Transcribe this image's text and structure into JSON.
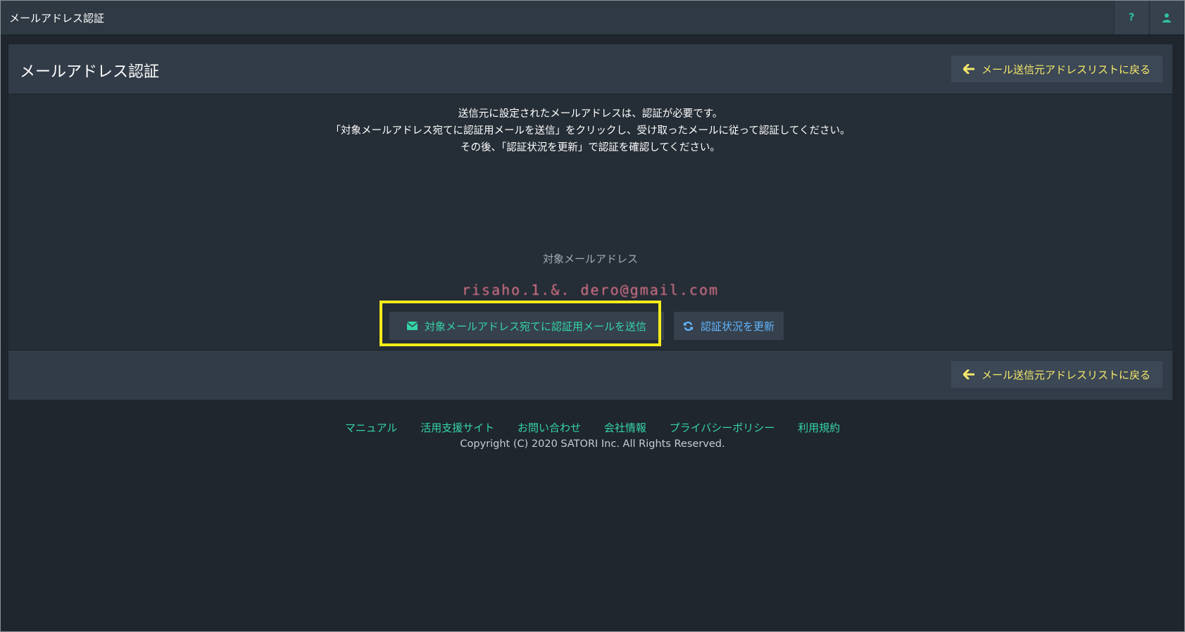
{
  "app": {
    "title": "メールアドレス認証"
  },
  "topbar": {
    "help_label": "?"
  },
  "page": {
    "title": "メールアドレス認証",
    "back_button": "メール送信元アドレスリストに戻る"
  },
  "instructions": {
    "line1": "送信元に設定されたメールアドレスは、認証が必要です。",
    "line2": "「対象メールアドレス宛てに認証用メールを送信」をクリックし、受け取ったメールに従って認証してください。",
    "line3": "その後、「認証状況を更新」で認証を確認してください。"
  },
  "target": {
    "label": "対象メールアドレス",
    "email": "risaho.1.&. dero@gmail.com"
  },
  "actions": {
    "send_label": "対象メールアドレス宛てに認証用メールを送信",
    "refresh_label": "認証状況を更新"
  },
  "footer": {
    "links": [
      "マニュアル",
      "活用支援サイト",
      "お問い合わせ",
      "会社情報",
      "プライバシーポリシー",
      "利用規約"
    ],
    "copyright": "Copyright (C) 2020 SATORI Inc. All Rights Reserved."
  },
  "colors": {
    "accent_green": "#35d4a7",
    "accent_yellow": "#f6e96a",
    "highlight": "#f5ec1a",
    "refresh_blue": "#62b6ff"
  },
  "icons": {
    "back": "arrow-left-icon",
    "send": "envelope-icon",
    "refresh": "refresh-icon",
    "user": "user-icon",
    "help": "question-icon"
  }
}
